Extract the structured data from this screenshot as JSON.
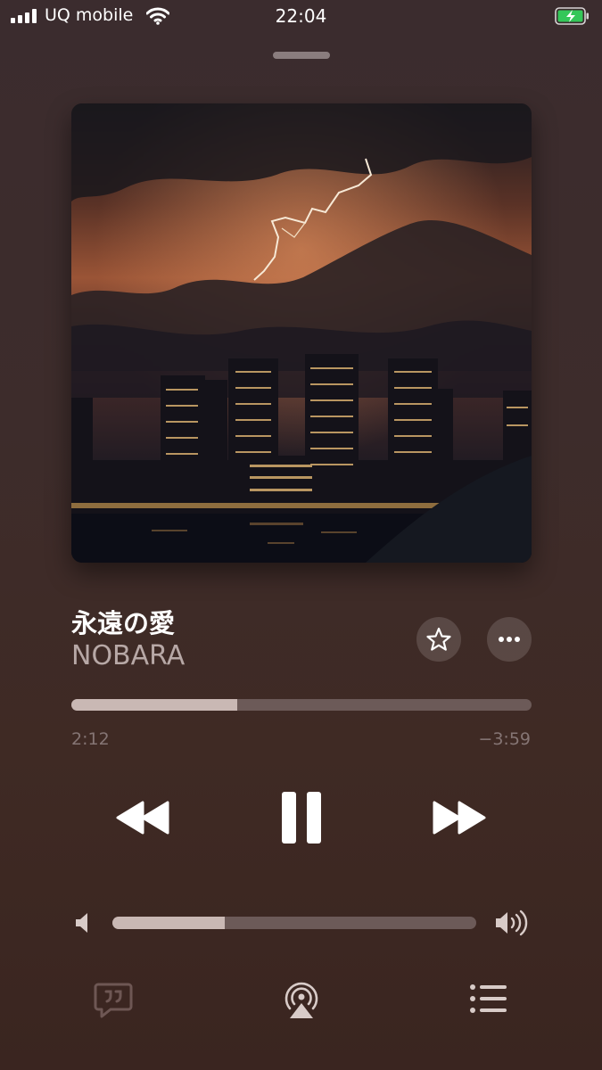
{
  "status_bar": {
    "carrier": "UQ mobile",
    "time": "22:04",
    "signal_bars": 4,
    "icons": [
      "signal-icon",
      "wifi-icon",
      "battery-charging-icon"
    ]
  },
  "now_playing": {
    "title": "永遠の愛",
    "artist": "NOBARA",
    "artwork_description_icon": "album-artwork",
    "elapsed": "2:12",
    "remaining": "−3:59",
    "progress_fraction": 0.36,
    "volume_fraction": 0.31
  },
  "controls": {
    "icons": [
      "star-icon",
      "more-icon",
      "rewind-icon",
      "pause-icon",
      "fast-forward-icon",
      "volume-low-icon",
      "volume-high-icon",
      "lyrics-icon",
      "airplay-icon",
      "queue-icon"
    ]
  },
  "colors": {
    "accent_fill": "#c9b8b4",
    "track": "#6c5a58",
    "secondary_text": "#b7a8a6",
    "battery_green": "#34c759"
  }
}
